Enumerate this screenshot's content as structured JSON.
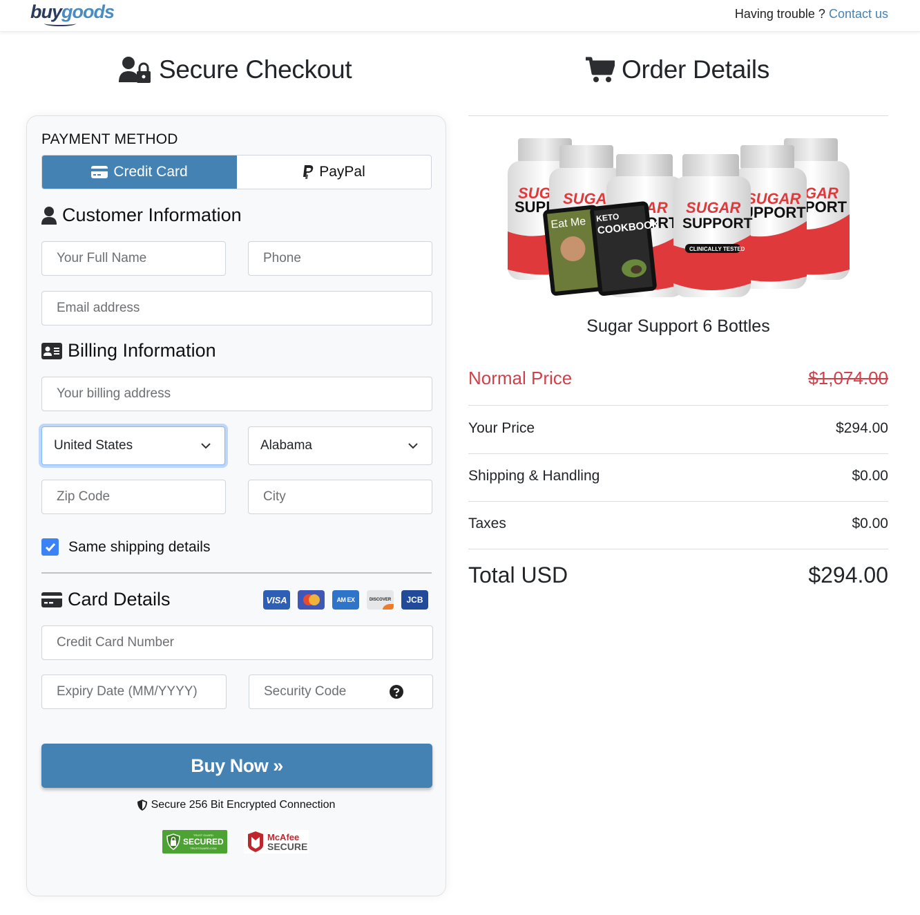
{
  "header": {
    "logo_part1": "buy",
    "logo_part2": "goods",
    "help_text": "Having trouble ? ",
    "contact_link": "Contact us"
  },
  "checkout": {
    "title": "Secure Checkout",
    "payment_method_label": "PAYMENT METHOD",
    "payment_tabs": [
      {
        "label": "Credit Card",
        "icon": "credit-card-icon",
        "active": true
      },
      {
        "label": "PayPal",
        "icon": "paypal-icon",
        "active": false
      }
    ],
    "customer_info": {
      "title": "Customer Information",
      "full_name_placeholder": "Your Full Name",
      "phone_placeholder": "Phone",
      "email_placeholder": "Email address"
    },
    "billing_info": {
      "title": "Billing Information",
      "address_placeholder": "Your billing address",
      "country_selected": "United States",
      "state_selected": "Alabama",
      "zip_placeholder": "Zip Code",
      "city_placeholder": "City"
    },
    "same_shipping": {
      "label": "Same shipping details",
      "checked": true
    },
    "card_details": {
      "title": "Card Details",
      "card_brands": [
        "VISA",
        "Mastercard",
        "AMEX",
        "DISCOVER",
        "JCB"
      ],
      "card_number_placeholder": "Credit Card Number",
      "expiry_placeholder": "Expiry Date (MM/YYYY)",
      "security_code_placeholder": "Security Code"
    },
    "buy_button": "Buy Now »",
    "secure_note": "Secure 256 Bit Encrypted Connection",
    "badges": {
      "trustguard_top": "TRUST GUARD",
      "trustguard_main": "SECURED",
      "trustguard_sub": "TRUSTGUARD.COM",
      "mcafee_top": "McAfee",
      "mcafee_main": "SECURE"
    }
  },
  "order": {
    "title": "Order Details",
    "product_name": "Sugar Support 6 Bottles",
    "product_image_texts": {
      "brand_top": "SUGAR",
      "brand_bottom": "SUPPORT",
      "tag": "CLINICALLY TESTED",
      "ebook1": "Eat Me",
      "ebook2_top": "KETO",
      "ebook2_main": "COOKBOOK"
    },
    "rows": [
      {
        "label": "Normal Price",
        "value": "$1,074.00"
      },
      {
        "label": "Your Price",
        "value": "$294.00"
      },
      {
        "label": "Shipping & Handling",
        "value": "$0.00"
      },
      {
        "label": "Taxes",
        "value": "$0.00"
      }
    ],
    "total_label": "Total USD",
    "total_value": "$294.00"
  },
  "colors": {
    "accent": "#4582b4",
    "normal_price": "#d0404a",
    "checkbox": "#3b82f6"
  }
}
